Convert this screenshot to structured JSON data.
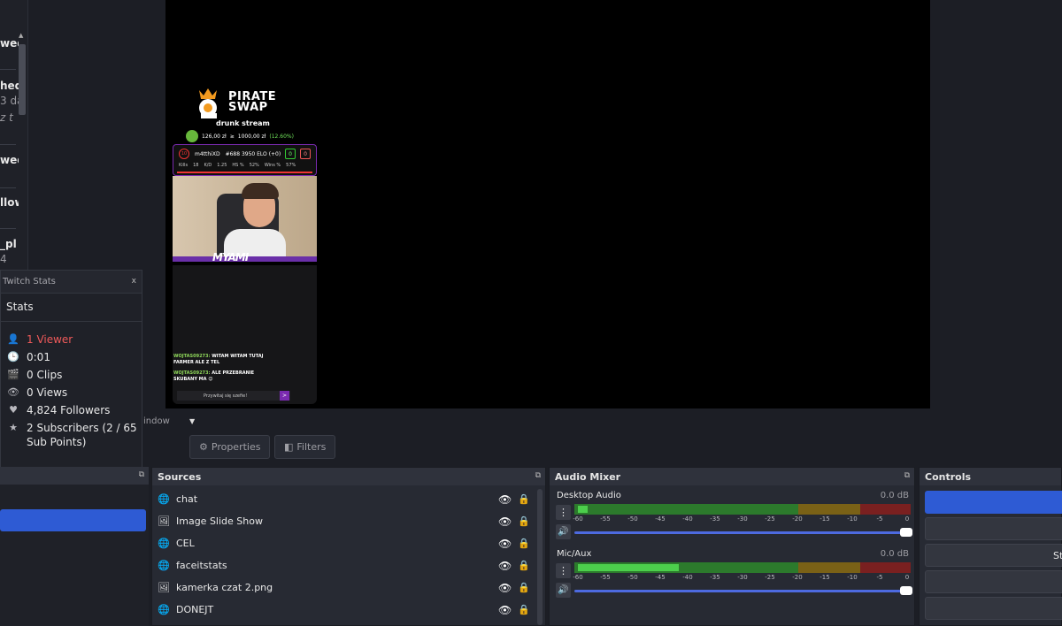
{
  "left_chat": {
    "fragments": [
      {
        "text": "wed",
        "sub": false
      },
      {
        "text": "hed",
        "sub": false
      },
      {
        "text": "3 da",
        "sub": true
      },
      {
        "text": "z t",
        "sub": true
      },
      {
        "text": "wed",
        "sub": false
      },
      {
        "text": "llow",
        "sub": false
      },
      {
        "text": "_pl",
        "sub": false
      },
      {
        "text": "4",
        "sub": true
      }
    ]
  },
  "overlay": {
    "logo_line1": "PIRATE",
    "logo_line2": "SWAP",
    "stream_title": "drunk stream",
    "wallet_amount": "126,00 zł",
    "wallet_sep": "≥",
    "wallet_target": "1000,00 zł",
    "wallet_pct": "(12.60%)",
    "faceit_level": "10",
    "faceit_player": "m4tthiXD",
    "faceit_rank": "#688 3950 ELO (+0)",
    "faceit_win": "0",
    "faceit_loss": "0",
    "faceit_kills_label": "Kills",
    "faceit_kills": "18",
    "faceit_kd_label": "K/D",
    "faceit_kd": "1.25",
    "faceit_hs_label": "HS %",
    "faceit_hs": "52%",
    "faceit_winrate_label": "Wins %",
    "faceit_winrate": "57%",
    "cam_signature": "MYAMI",
    "chat": [
      {
        "nick": "WOJTAS09273:",
        "msg": "WITAM WITAM TUTAJ"
      },
      {
        "nick": "",
        "msg": "FARMER ALE Z TEL"
      },
      {
        "nick": "WOJTAS09273:",
        "msg": "ALE PRZEBRANIE"
      },
      {
        "nick": "",
        "msg": "SKUBANY MA 😊"
      }
    ],
    "chat_input_placeholder": "Przywitaj się szefie!",
    "chat_send": ">"
  },
  "stats_panel": {
    "title": "Twitch Stats",
    "close": "x",
    "header": "Stats",
    "items": [
      {
        "icon": "user-icon",
        "glyph": "👤",
        "text": "1 Viewer",
        "highlight": true
      },
      {
        "icon": "clock-icon",
        "glyph": "🕒",
        "text": "0:01",
        "highlight": false
      },
      {
        "icon": "clapper-icon",
        "glyph": "🎬",
        "text": "0 Clips",
        "highlight": false
      },
      {
        "icon": "eye-icon",
        "glyph": "👁",
        "text": "0 Views",
        "highlight": false
      },
      {
        "icon": "heart-icon",
        "glyph": "♥",
        "text": "4,824 Followers",
        "highlight": false
      },
      {
        "icon": "star-icon",
        "glyph": "★",
        "text": "2 Subscribers (2 / 65 Sub Points)",
        "highlight": false
      }
    ]
  },
  "toolbar": {
    "window_label": "indow",
    "properties_label": "Properties",
    "filters_label": "Filters"
  },
  "sources": {
    "title": "Sources",
    "items": [
      {
        "icon": "globe-icon",
        "glyph": "🌐",
        "name": "chat"
      },
      {
        "icon": "slideshow-icon",
        "glyph": "🖼",
        "name": "Image Slide Show"
      },
      {
        "icon": "globe-icon",
        "glyph": "🌐",
        "name": "CEL"
      },
      {
        "icon": "globe-icon",
        "glyph": "🌐",
        "name": "faceitstats"
      },
      {
        "icon": "image-icon",
        "glyph": "🖼",
        "name": "kamerka czat 2.png"
      },
      {
        "icon": "globe-icon",
        "glyph": "🌐",
        "name": "DONEJT"
      }
    ]
  },
  "mixer": {
    "title": "Audio Mixer",
    "ticks": [
      "-60",
      "-55",
      "-50",
      "-45",
      "-40",
      "-35",
      "-30",
      "-25",
      "-20",
      "-15",
      "-10",
      "-5",
      "0"
    ],
    "channels": [
      {
        "name": "Desktop Audio",
        "db": "0.0 dB",
        "level": 0.04
      },
      {
        "name": "Mic/Aux",
        "db": "0.0 dB",
        "level": 0.31
      }
    ]
  },
  "controls": {
    "title": "Controls",
    "btn3_partial": "St"
  },
  "colors": {
    "accent_blue": "#2e5bd4",
    "viewer_red": "#ef5a5a",
    "meter_green": "#4ccf4c",
    "meter_yellow": "#c8a534",
    "meter_red": "#d94545"
  }
}
